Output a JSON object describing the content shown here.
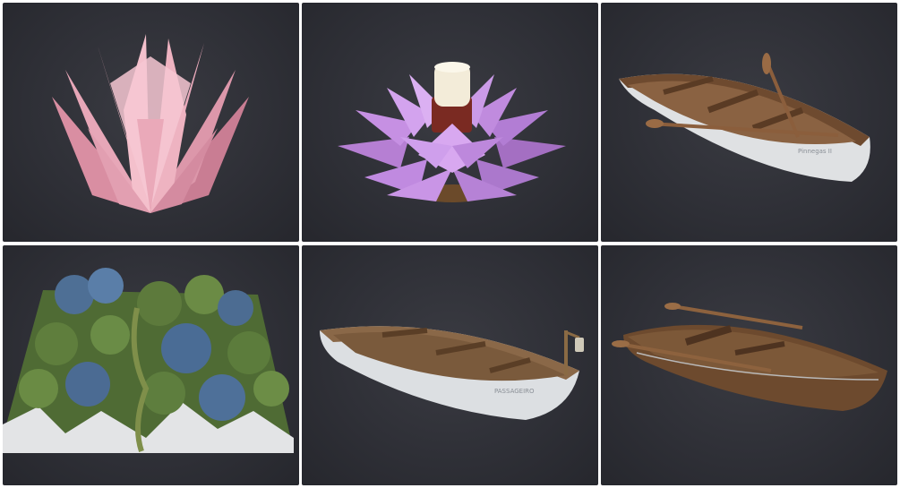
{
  "gallery": {
    "tiles": [
      {
        "subject": "pink-origami-lotus"
      },
      {
        "subject": "purple-lotus-candle-holder"
      },
      {
        "subject": "wooden-rowboat-with-oars"
      },
      {
        "subject": "mountain-terrain-model"
      },
      {
        "subject": "white-rowboat-with-lantern"
      },
      {
        "subject": "wooden-rowboat-angled"
      }
    ]
  },
  "colors": {
    "tile_background": "#2f3037",
    "page_background": "#ffffff",
    "lotus_pink": "#e8a3b3",
    "lotus_purple": "#c68be0",
    "wood": "#7a5234",
    "hull_white": "#dfe1e3",
    "terrain_green": "#5f7a3a",
    "terrain_blue": "#4a6e9a"
  }
}
